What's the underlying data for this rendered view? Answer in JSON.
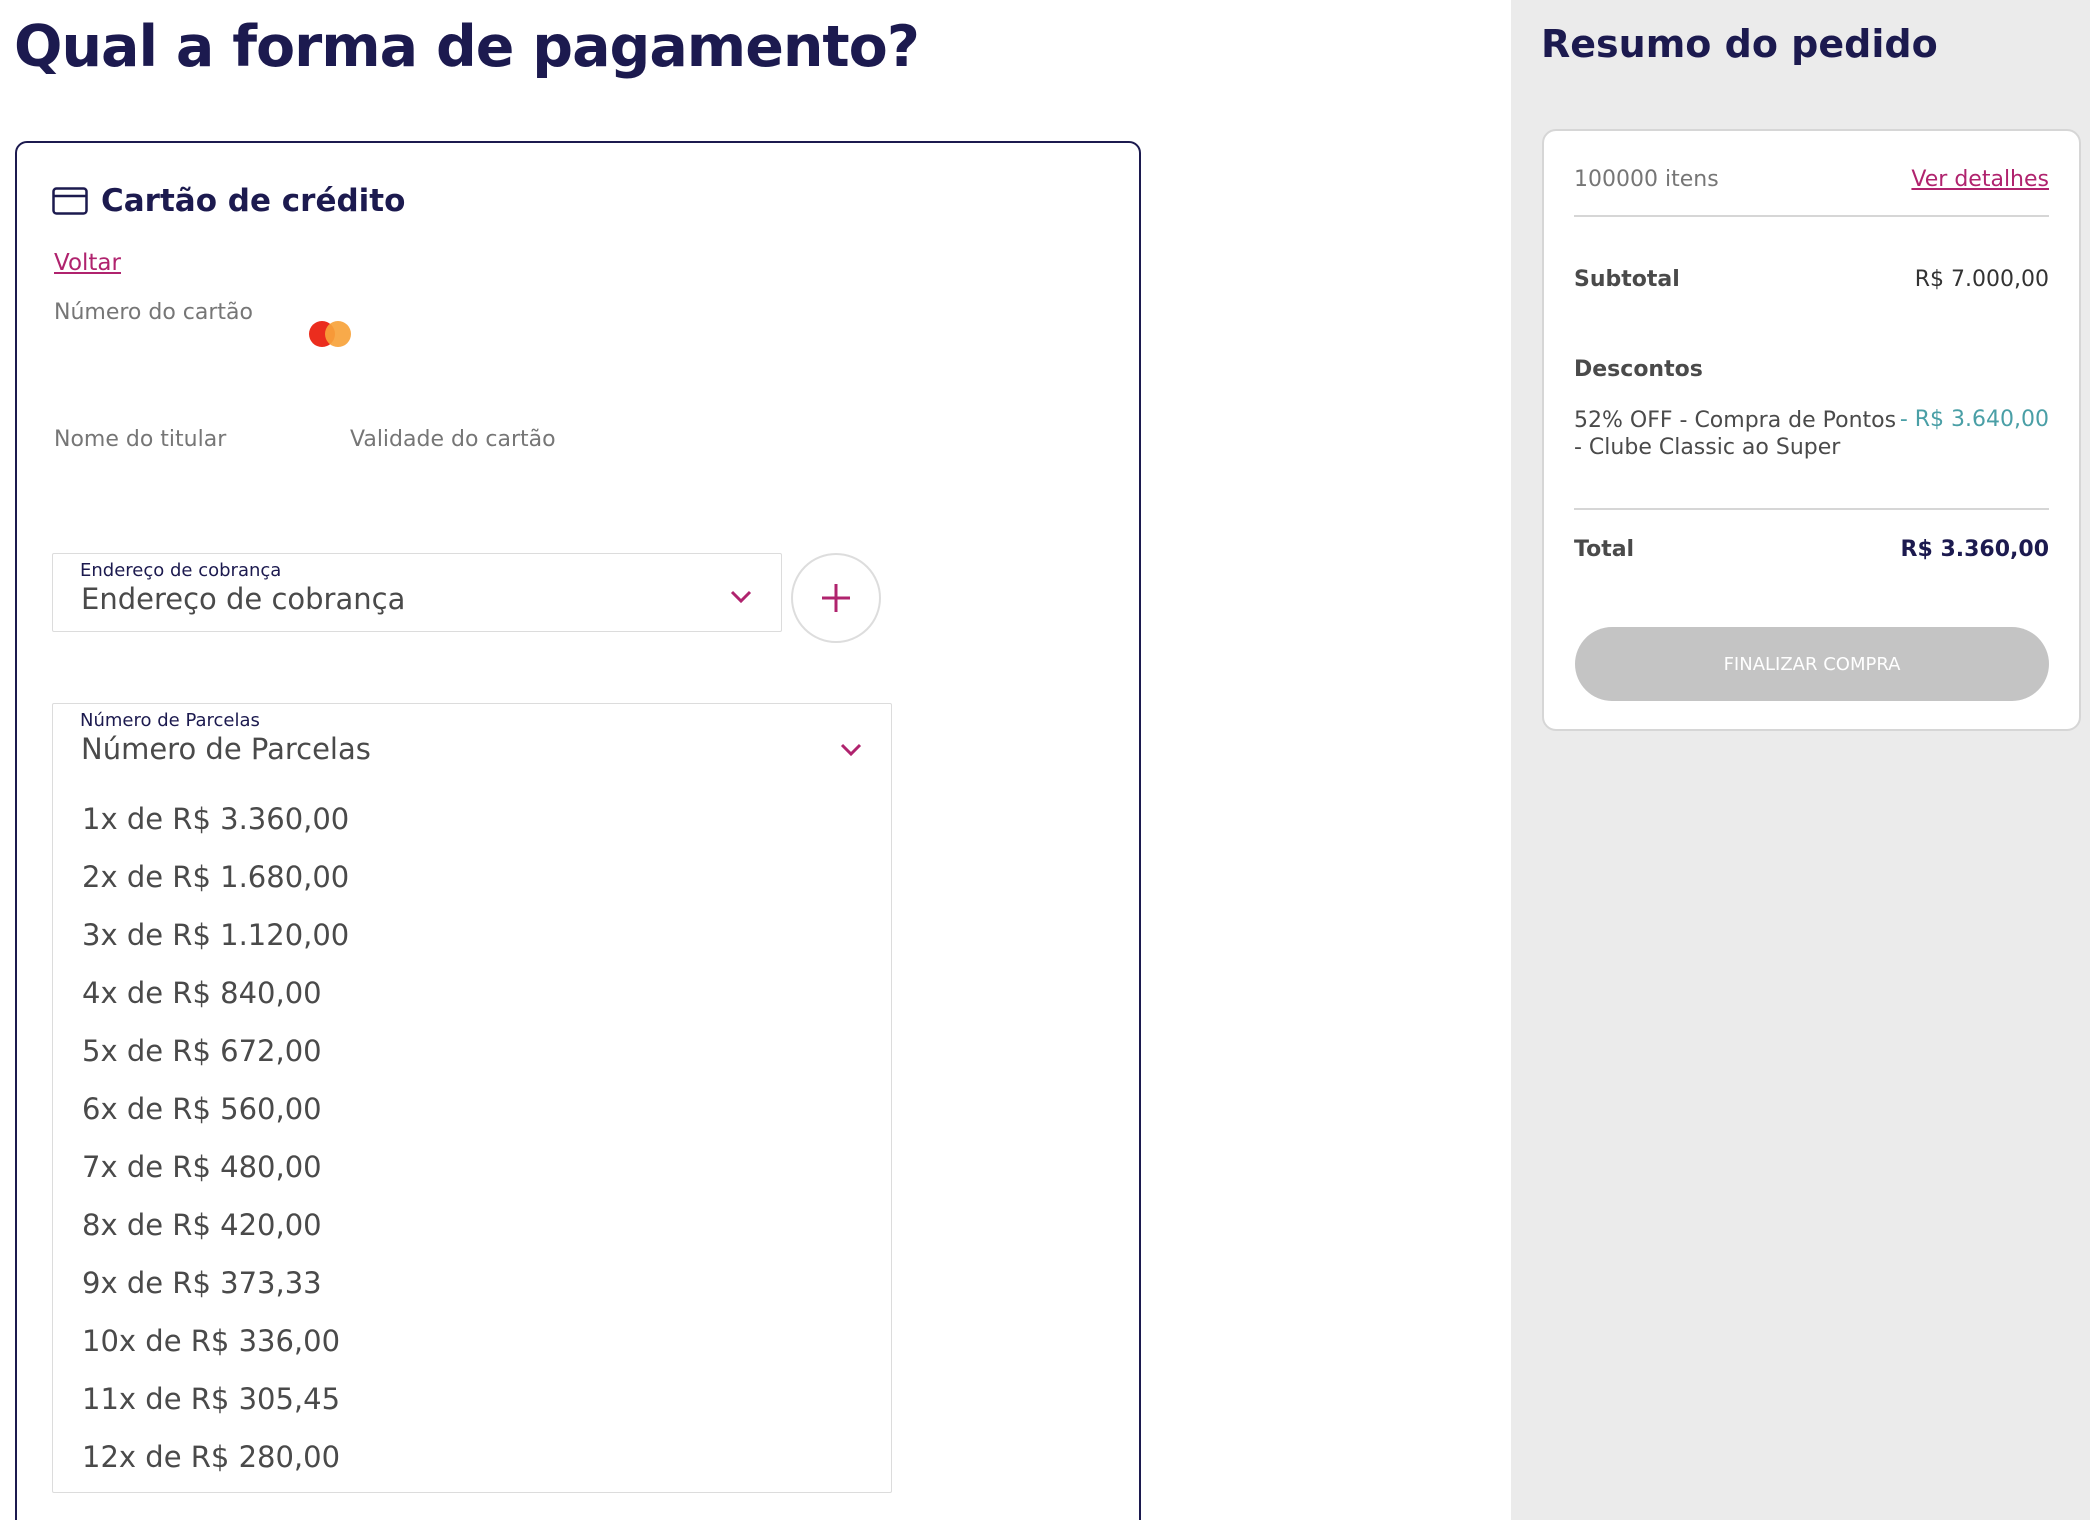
{
  "page": {
    "title": "Qual a forma de pagamento?"
  },
  "payment": {
    "method_title": "Cartão de crédito",
    "method_icon": "credit-card-icon",
    "back_label": "Voltar",
    "card_number_label": "Número do cartão",
    "card_brand_icon": "mastercard-icon",
    "holder_label": "Nome do titular",
    "validity_label": "Validade do cartão",
    "billing": {
      "float_label": "Endereço de cobrança",
      "value": "Endereço de cobrança",
      "add_icon": "plus-icon"
    },
    "installments": {
      "float_label": "Número de Parcelas",
      "value": "Número de Parcelas",
      "options": [
        "1x de R$ 3.360,00",
        "2x de R$ 1.680,00",
        "3x de R$ 1.120,00",
        "4x de R$ 840,00",
        "5x de R$ 672,00",
        "6x de R$ 560,00",
        "7x de R$ 480,00",
        "8x de R$ 420,00",
        "9x de R$ 373,33",
        "10x de R$ 336,00",
        "11x de R$ 305,45",
        "12x de R$ 280,00"
      ]
    }
  },
  "summary": {
    "title": "Resumo do pedido",
    "items_count": "100000 itens",
    "details_link": "Ver detalhes",
    "subtotal_label": "Subtotal",
    "subtotal_value": "R$ 7.000,00",
    "discounts_label": "Descontos",
    "discount_desc": "52% OFF - Compra de Pontos - Clube Classic ao Super",
    "discount_value": "- R$ 3.640,00",
    "total_label": "Total",
    "total_value": "R$ 3.360,00",
    "finalize_label": "FINALIZAR COMPRA"
  },
  "colors": {
    "brand_navy": "#1c1a4f",
    "accent_magenta": "#b0236e",
    "discount_teal": "#4a9fa6",
    "disabled_button": "#c4c4c4",
    "sidebar_bg": "#ebebeb"
  }
}
